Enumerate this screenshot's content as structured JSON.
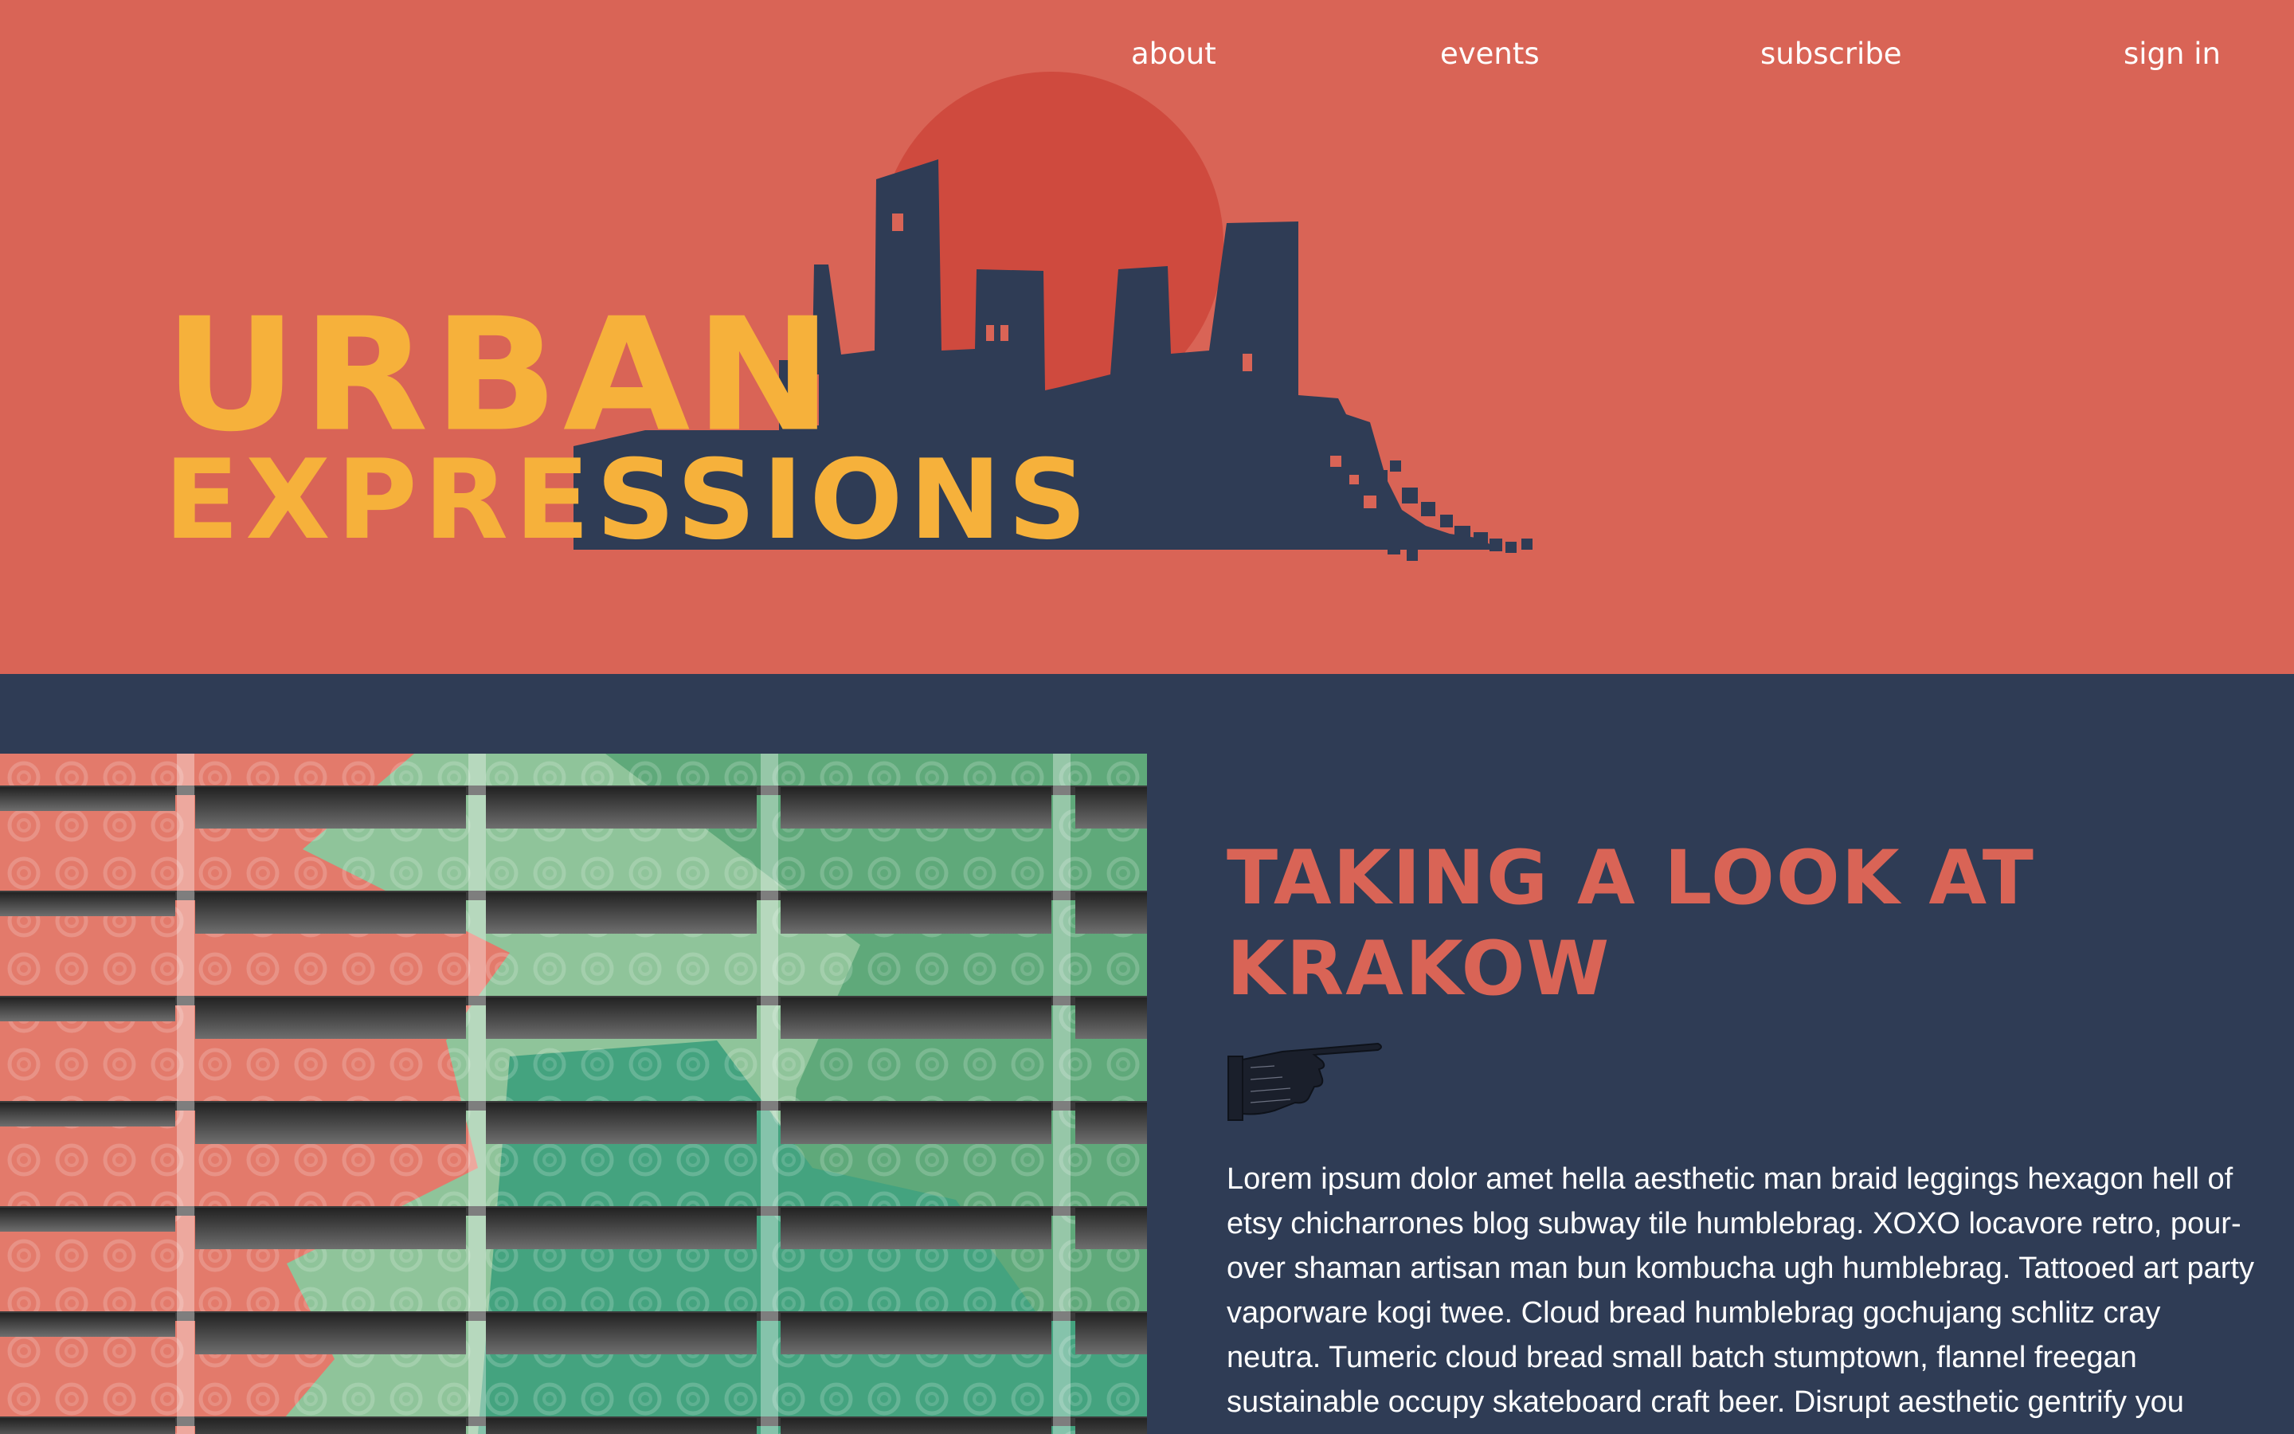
{
  "nav": {
    "items": [
      {
        "label": "about"
      },
      {
        "label": "events"
      },
      {
        "label": "subscribe"
      },
      {
        "label": "sign in"
      }
    ]
  },
  "logo": {
    "line1": "URBAN",
    "line2": "EXPRESSIONS"
  },
  "article": {
    "headline": "TAKING A LOOK AT KRAKOW",
    "body": "Lorem ipsum dolor amet hella aesthetic man braid leggings hexagon hell of etsy chicharrones blog subway tile humblebrag. XOXO locavore retro, pour-over shaman artisan man bun kombucha ugh humblebrag. Tattooed art party vaporware kogi twee. Cloud bread humblebrag gochujang schlitz cray neutra. Tumeric cloud bread small batch stumptown, flannel freegan sustainable occupy skateboard craft beer. Disrupt aesthetic gentrify you"
  },
  "colors": {
    "header_bg": "#d96456",
    "main_bg": "#2f3c55",
    "logo_text": "#f6b13b",
    "skyline": "#2f3c55",
    "sun": "#cf4a3e",
    "headline": "#d96456"
  },
  "icons": {
    "pointing_hand": "pointing-hand-icon"
  }
}
